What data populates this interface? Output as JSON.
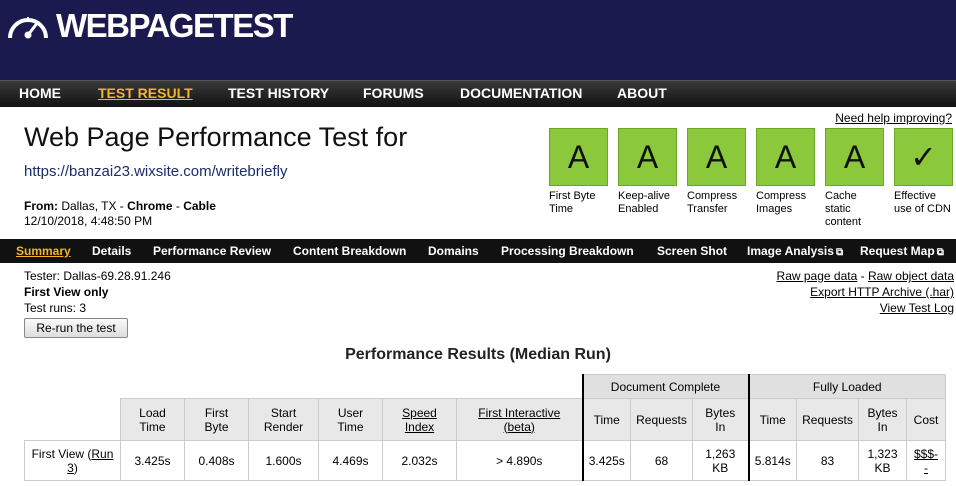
{
  "header": {
    "logo_text": "WEBPAGETEST",
    "logo_icon": "speedometer-icon"
  },
  "nav": {
    "items": [
      {
        "label": "HOME",
        "active": false
      },
      {
        "label": "TEST RESULT",
        "active": true
      },
      {
        "label": "TEST HISTORY",
        "active": false
      },
      {
        "label": "FORUMS",
        "active": false
      },
      {
        "label": "DOCUMENTATION",
        "active": false
      },
      {
        "label": "ABOUT",
        "active": false
      }
    ]
  },
  "page": {
    "title": "Web Page Performance Test for",
    "url": "https://banzai23.wixsite.com/writebriefly",
    "from_label": "From:",
    "from_value": "Dallas, TX -",
    "browser": "Chrome",
    "sep": "-",
    "connection": "Cable",
    "date": "12/10/2018, 4:48:50 PM",
    "help_link": "Need help improving?"
  },
  "grades": [
    {
      "grade": "A",
      "label_1": "First Byte",
      "label_2": "Time",
      "label_3": ""
    },
    {
      "grade": "A",
      "label_1": "Keep-alive",
      "label_2": "Enabled",
      "label_3": ""
    },
    {
      "grade": "A",
      "label_1": "Compress",
      "label_2": "Transfer",
      "label_3": ""
    },
    {
      "grade": "A",
      "label_1": "Compress",
      "label_2": "Images",
      "label_3": ""
    },
    {
      "grade": "A",
      "label_1": "Cache",
      "label_2": "static",
      "label_3": "content"
    },
    {
      "grade": "✓",
      "label_1": "Effective",
      "label_2": "use of CDN",
      "label_3": ""
    }
  ],
  "grade_color": "#8cc83c",
  "subnav": {
    "items": [
      {
        "label": "Summary",
        "active": true
      },
      {
        "label": "Details"
      },
      {
        "label": "Performance Review"
      },
      {
        "label": "Content Breakdown"
      },
      {
        "label": "Domains"
      },
      {
        "label": "Processing Breakdown"
      },
      {
        "label": "Screen Shot"
      },
      {
        "label": "Image Analysis"
      },
      {
        "label": "Request Map"
      }
    ]
  },
  "info": {
    "tester": "Tester: Dallas-69.28.91.246",
    "first_view": "First View only",
    "test_runs": "Test runs: 3",
    "rerun_button": "Re-run the test"
  },
  "raw_links": {
    "raw_page": "Raw page data",
    "dash": " - ",
    "raw_object": "Raw object data",
    "export": "Export HTTP Archive (.har)",
    "test_log": "View Test Log"
  },
  "results": {
    "title": "Performance Results (Median Run)",
    "group_doc": "Document Complete",
    "group_full": "Fully Loaded",
    "headers": {
      "load_time": [
        "Load",
        "Time"
      ],
      "first_byte": [
        "First",
        "Byte"
      ],
      "start_render": [
        "Start",
        "Render"
      ],
      "user_time": [
        "User",
        "Time"
      ],
      "speed_index": [
        "Speed",
        "Index"
      ],
      "first_interactive": [
        "First Interactive",
        "(beta)"
      ],
      "doc_time": "Time",
      "doc_requests": "Requests",
      "doc_bytes": [
        "Bytes",
        "In"
      ],
      "full_time": "Time",
      "full_requests": "Requests",
      "full_bytes": [
        "Bytes",
        "In"
      ],
      "cost": "Cost"
    },
    "row": {
      "label": "First View (",
      "run_link_1": "Run",
      "run_link_2": "3",
      "label_end": ")",
      "load_time": "3.425s",
      "first_byte": "0.408s",
      "start_render": "1.600s",
      "user_time": "4.469s",
      "speed_index": "2.032s",
      "first_interactive": "> 4.890s",
      "doc_time": "3.425s",
      "doc_requests": "68",
      "doc_bytes_1": "1,263",
      "doc_bytes_2": "KB",
      "full_time": "5.814s",
      "full_requests": "83",
      "full_bytes_1": "1,323",
      "full_bytes_2": "KB",
      "cost_1": "$$$-",
      "cost_2": "-"
    }
  }
}
